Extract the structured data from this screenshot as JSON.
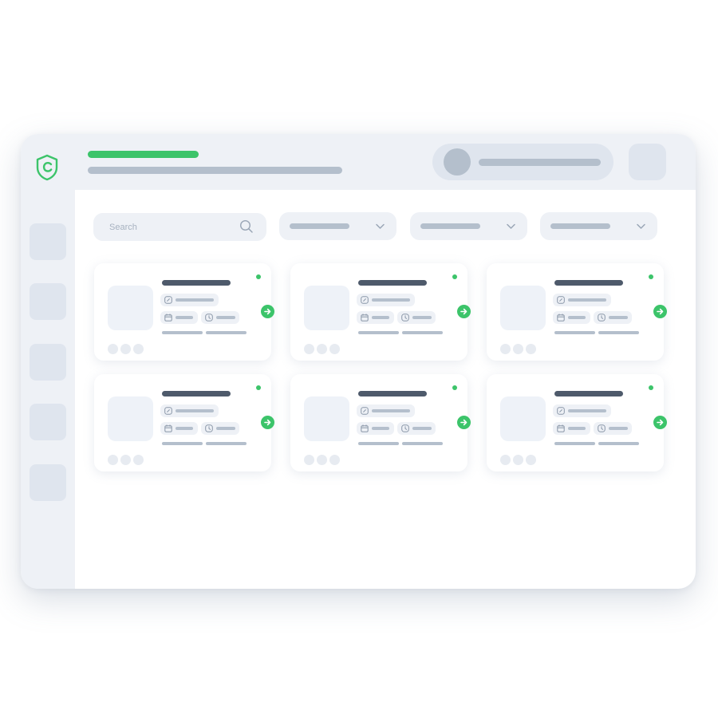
{
  "app": {
    "logo_icon": "shield-c-logo-icon",
    "accent_color": "#3cc46a",
    "ink_color": "#4e5a6b",
    "placeholder_color": "#b4bfcc",
    "panel_color": "#eef1f6"
  },
  "search": {
    "placeholder": "Search",
    "icon": "search-icon"
  },
  "filters": [
    {
      "icon": "chevron-down-icon"
    },
    {
      "icon": "chevron-down-icon"
    },
    {
      "icon": "chevron-down-icon"
    }
  ],
  "card_icons": {
    "tag": "tag-icon",
    "date": "calendar-icon",
    "time": "clock-icon",
    "action": "arrow-right-icon",
    "status": "status-dot-online"
  },
  "card_count": 6
}
